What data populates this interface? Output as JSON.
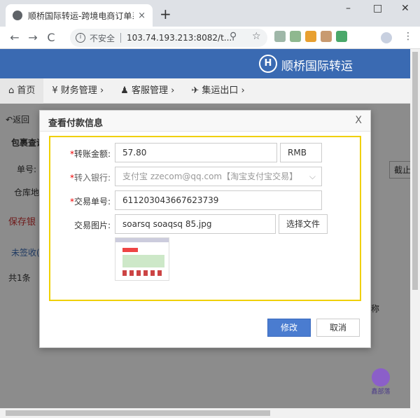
{
  "browser": {
    "tab_title": "顺桥国际转运-跨境电商订单系统",
    "tab_close": "×",
    "new_tab": "+",
    "insecure_label": "不安全",
    "url": "103.74.193.213:8082/t...",
    "nav_back": "←",
    "nav_forward": "→",
    "nav_reload": "C",
    "zoom_icon": "⚲",
    "star_icon": "☆",
    "menu_icon": "⋮",
    "minimize": "–",
    "maximize": "□",
    "close": "✕"
  },
  "header": {
    "logo_glyph": "H",
    "brand": "顺桥国际转运"
  },
  "nav": {
    "items": [
      "首页",
      "¥ 财务管理",
      "客服管理",
      "集运出口"
    ]
  },
  "background": {
    "back": "返回",
    "section": "包裹查询",
    "single_no": "单号:",
    "warehouse": "仓库地",
    "save_link": "保存银",
    "intercept_btn": "截止",
    "unsigned": "未签收(",
    "total": "共1条",
    "col_hint": "称"
  },
  "modal": {
    "title": "查看付款信息",
    "close": "X",
    "amount": {
      "label": "转账金额:",
      "value": "57.80",
      "currency": "RMB"
    },
    "bank": {
      "label": "转入银行:",
      "value": "支付宝 zzecom@qq.com【淘宝支付宝交易】"
    },
    "txn": {
      "label": "交易单号:",
      "value": "611203043667623739"
    },
    "image": {
      "label": "交易图片:",
      "filename": "soarsq soaqsq 85.jpg",
      "choose_label": "选择文件"
    },
    "submit_label": "修改",
    "cancel_label": "取消"
  },
  "watermark": {
    "text": "鑫部落"
  }
}
